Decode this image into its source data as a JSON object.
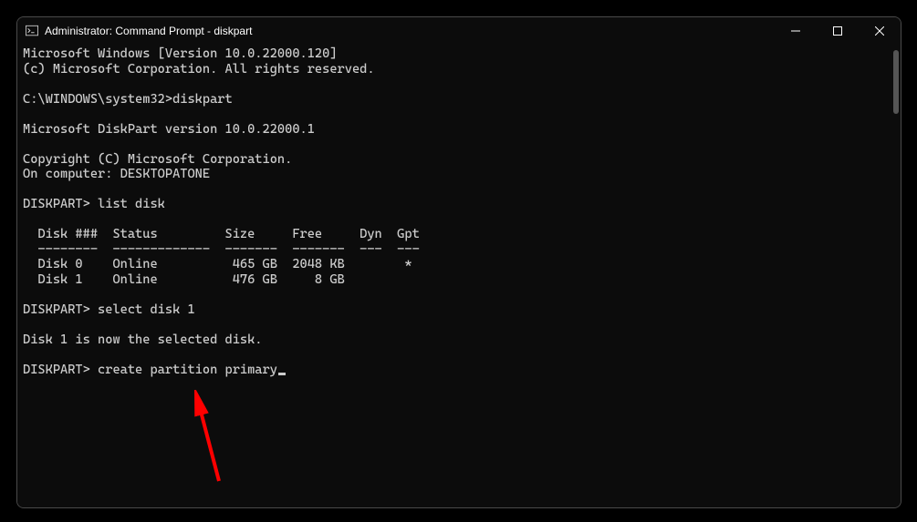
{
  "titlebar": {
    "title": "Administrator: Command Prompt - diskpart"
  },
  "lines": {
    "l0": "Microsoft Windows [Version 10.0.22000.120]",
    "l1": "(c) Microsoft Corporation. All rights reserved.",
    "l2": "",
    "l3": "C:\\WINDOWS\\system32>diskpart",
    "l4": "",
    "l5": "Microsoft DiskPart version 10.0.22000.1",
    "l6": "",
    "l7": "Copyright (C) Microsoft Corporation.",
    "l8": "On computer: DESKTOPATONE",
    "l9": "",
    "l10": "DISKPART> list disk",
    "l11": "",
    "l12": "  Disk ###  Status         Size     Free     Dyn  Gpt",
    "l13": "  --------  -------------  -------  -------  ---  ---",
    "l14": "  Disk 0    Online          465 GB  2048 KB        *",
    "l15": "  Disk 1    Online          476 GB     8 GB",
    "l16": "",
    "l17": "DISKPART> select disk 1",
    "l18": "",
    "l19": "Disk 1 is now the selected disk.",
    "l20": "",
    "l21": "DISKPART> create partition primary"
  }
}
